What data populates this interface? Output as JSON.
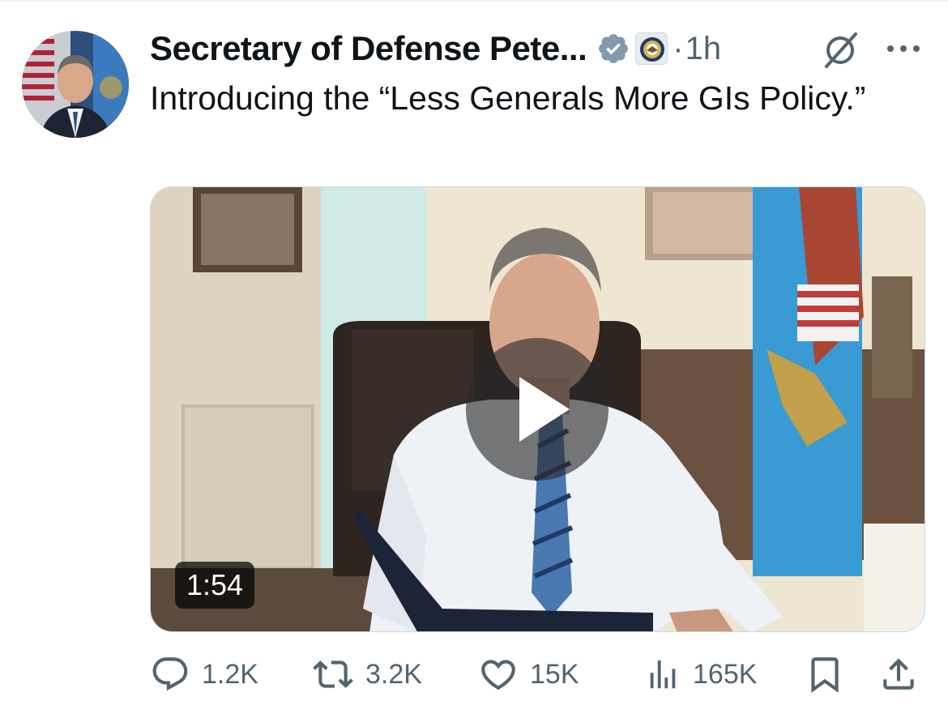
{
  "tweet": {
    "author_name": "Secretary of Defense Pete...",
    "timestamp": "1h",
    "separator": "·",
    "text": "Introducing the “Less Generals More GIs Policy.”"
  },
  "media": {
    "duration": "1:54"
  },
  "actions": {
    "replies": "1.2K",
    "reposts": "3.2K",
    "likes": "15K",
    "views": "165K"
  },
  "icons": {
    "verified": "verified-badge-icon",
    "affiliate": "dod-seal-icon",
    "grok": "grok-icon",
    "more": "more-dots-icon",
    "play": "play-icon",
    "reply": "reply-icon",
    "repost": "repost-icon",
    "like": "heart-icon",
    "views": "views-chart-icon",
    "bookmark": "bookmark-icon",
    "share": "share-icon"
  },
  "colors": {
    "text_primary": "#0f1419",
    "text_secondary": "#536471",
    "verified_badge": "#829aab",
    "border": "#cfd9de"
  }
}
